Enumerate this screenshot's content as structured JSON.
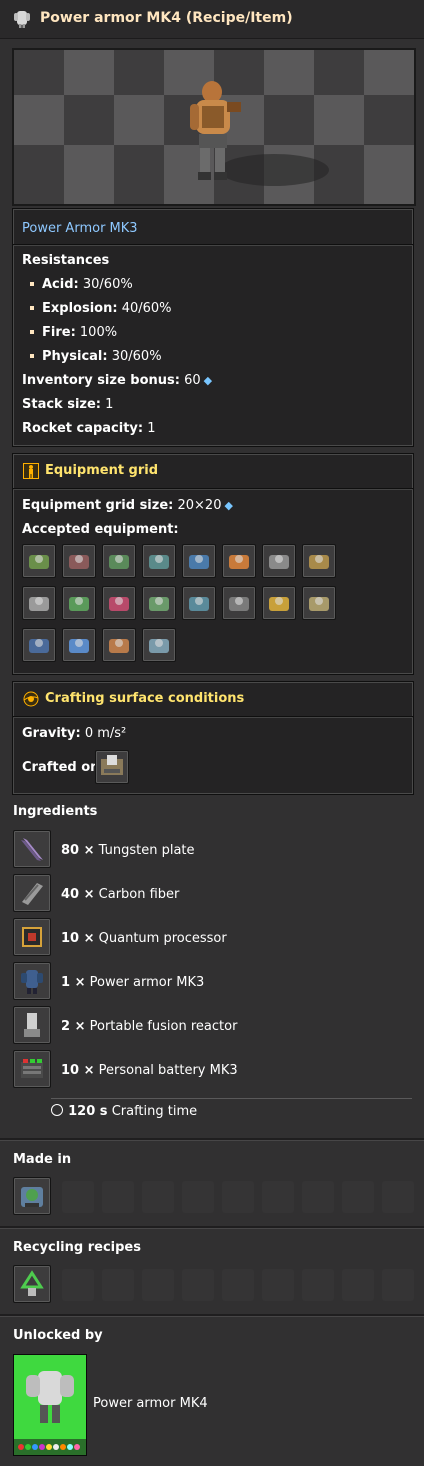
{
  "window": {
    "title": "Power armor MK4 (Recipe/Item)"
  },
  "item_info": {
    "previous_tier_link": "Power Armor MK3",
    "resistances_heading": "Resistances",
    "resistances": [
      {
        "name": "Acid:",
        "value": "30/60%"
      },
      {
        "name": "Explosion:",
        "value": "40/60%"
      },
      {
        "name": "Fire:",
        "value": "100%"
      },
      {
        "name": "Physical:",
        "value": "30/60%"
      }
    ],
    "inventory_bonus_label": "Inventory size bonus:",
    "inventory_bonus_value": "60",
    "stack_size_label": "Stack size:",
    "stack_size_value": "1",
    "rocket_capacity_label": "Rocket capacity:",
    "rocket_capacity_value": "1"
  },
  "equipment_grid": {
    "title": "Equipment grid",
    "size_label": "Equipment grid size:",
    "size_value": "20×20",
    "accepted_label": "Accepted equipment:",
    "items": [
      "battery-icon",
      "battery-mk2-icon",
      "battery-mk3-icon",
      "exoskeleton-icon",
      "energy-shield-icon",
      "energy-shield-mk2-icon",
      "personal-roboport-icon",
      "personal-laser-defense-icon",
      "fusion-reactor-icon",
      "night-vision-icon",
      "discharge-defense-icon",
      "night-vision-mk2-icon",
      "exoskeleton-mk2-icon",
      "toolbelt-icon",
      "personal-roboport-mk2-icon",
      "portable-fission-icon",
      "belt-immunity-icon",
      "solar-panel-icon",
      "toolbelt-2-icon",
      "robot-equipment-icon"
    ]
  },
  "crafting_conditions": {
    "title": "Crafting surface conditions",
    "gravity_label": "Gravity:",
    "gravity_value": "0 m/s²",
    "crafted_on_label": "Crafted on:"
  },
  "ingredients": {
    "title": "Ingredients",
    "items": [
      {
        "amount": "80 ×",
        "name": "Tungsten plate",
        "icon": "tungsten-plate-icon"
      },
      {
        "amount": "40 ×",
        "name": "Carbon fiber",
        "icon": "carbon-fiber-icon"
      },
      {
        "amount": "10 ×",
        "name": "Quantum processor",
        "icon": "quantum-processor-icon"
      },
      {
        "amount": "1 ×",
        "name": "Power armor MK3",
        "icon": "power-armor-mk3-icon"
      },
      {
        "amount": "2 ×",
        "name": "Portable fusion reactor",
        "icon": "portable-fusion-reactor-icon"
      },
      {
        "amount": "10 ×",
        "name": "Personal battery MK3",
        "icon": "personal-battery-mk3-icon"
      }
    ],
    "crafting_time_value": "120 s",
    "crafting_time_label": "Crafting time"
  },
  "made_in": {
    "title": "Made in"
  },
  "recycling": {
    "title": "Recycling recipes"
  },
  "unlocked_by": {
    "title": "Unlocked by",
    "technology": "Power armor MK4"
  },
  "colors": {
    "background": "#313031",
    "panel": "#242324",
    "heading_yellow": "#ffe46e",
    "link_blue": "#8ec8ff",
    "technology_green": "#3fd93f"
  }
}
